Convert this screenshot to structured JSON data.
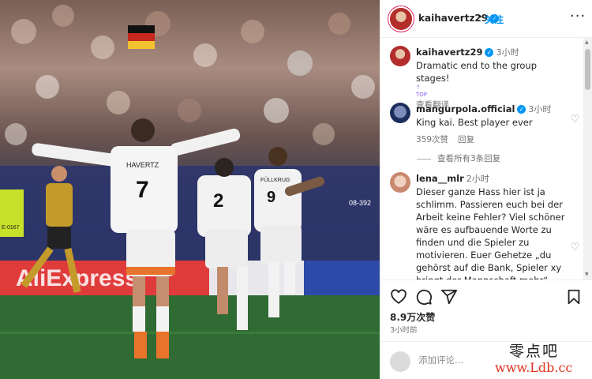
{
  "post": {
    "author": "kaihavertz29",
    "follow_label": "关注",
    "dot": "•",
    "more_icon": "more-horizontal-icon"
  },
  "photo": {
    "banner_text": "AliExpress",
    "jersey_left_name": "HAVERTZ",
    "jersey_left_number": "7",
    "jersey_center_number": "2",
    "jersey_right_name": "FÜLLKRUG",
    "jersey_right_number": "9",
    "board_number": "08-392",
    "vest_number": "E-0167"
  },
  "caption": {
    "name": "kaihavertz29",
    "time": "3小时",
    "text": "Dramatic end to the group stages!",
    "top_badge": "TOP",
    "translate": "查看翻译"
  },
  "comments": [
    {
      "name": "mangurpola.official",
      "time": "3小时",
      "text": "King kai. Best player ever",
      "likes": "359次赞",
      "reply": "回复",
      "view_replies": "查看所有3条回复"
    },
    {
      "name": "lena__mlr",
      "time": "2小时",
      "text": "Dieser ganze Hass hier ist ja schlimm. Passieren euch bei der Arbeit keine Fehler? Viel schöner wäre es aufbauende Worte zu finden und die Spieler zu motivieren. Euer Gehetze „du gehörst auf die Bank, Spieler xy bringt der Mannschaft mehr“ schadet jeglicher Leistung..."
    }
  ],
  "actions": {
    "likes": "8.9万次赞",
    "posted": "3小时前"
  },
  "add_comment": {
    "placeholder": "添加评论..."
  },
  "watermark": {
    "top": "零点吧",
    "bottom": "www.Ldb.cc"
  },
  "colors": {
    "link": "#0095f6",
    "verified": "#0095f6",
    "muted": "#737373",
    "pitch": "#2f6b33",
    "jersey_trim": "#e8732a"
  }
}
